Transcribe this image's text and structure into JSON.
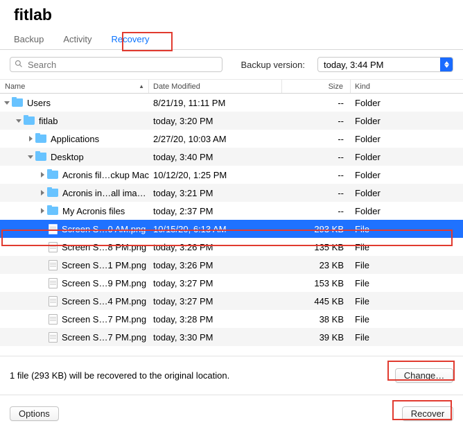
{
  "header": {
    "title": "fitlab"
  },
  "tabs": [
    {
      "label": "Backup",
      "active": false
    },
    {
      "label": "Activity",
      "active": false
    },
    {
      "label": "Recovery",
      "active": true
    }
  ],
  "search": {
    "placeholder": "Search"
  },
  "backup_version": {
    "label": "Backup version:",
    "value": "today, 3:44 PM"
  },
  "columns": [
    "Name",
    "Date Modified",
    "Size",
    "Kind"
  ],
  "rows": [
    {
      "depth": 0,
      "hasChildren": true,
      "open": true,
      "icon": "folder",
      "name": "Users",
      "date": "8/21/19, 11:11 PM",
      "size": "--",
      "kind": "Folder",
      "selected": false
    },
    {
      "depth": 1,
      "hasChildren": true,
      "open": true,
      "icon": "folder",
      "name": "fitlab",
      "date": "today, 3:20 PM",
      "size": "--",
      "kind": "Folder",
      "selected": false
    },
    {
      "depth": 2,
      "hasChildren": true,
      "open": false,
      "icon": "folder",
      "name": "Applications",
      "date": "2/27/20, 10:03 AM",
      "size": "--",
      "kind": "Folder",
      "selected": false
    },
    {
      "depth": 2,
      "hasChildren": true,
      "open": true,
      "icon": "folder",
      "name": "Desktop",
      "date": "today, 3:40 PM",
      "size": "--",
      "kind": "Folder",
      "selected": false
    },
    {
      "depth": 3,
      "hasChildren": true,
      "open": false,
      "icon": "folder",
      "name": "Acronis fil…ckup Mac",
      "date": "10/12/20, 1:25 PM",
      "size": "--",
      "kind": "Folder",
      "selected": false
    },
    {
      "depth": 3,
      "hasChildren": true,
      "open": false,
      "icon": "folder",
      "name": "Acronis in…all images",
      "date": "today, 3:21 PM",
      "size": "--",
      "kind": "Folder",
      "selected": false
    },
    {
      "depth": 3,
      "hasChildren": true,
      "open": false,
      "icon": "folder",
      "name": "My Acronis files",
      "date": "today, 2:37 PM",
      "size": "--",
      "kind": "Folder",
      "selected": false
    },
    {
      "depth": 3,
      "hasChildren": false,
      "open": false,
      "icon": "file",
      "name": "Screen S…0 AM.png",
      "date": "10/15/20, 6:13 AM",
      "size": "293 KB",
      "kind": "File",
      "selected": true
    },
    {
      "depth": 3,
      "hasChildren": false,
      "open": false,
      "icon": "file",
      "name": "Screen S…8 PM.png",
      "date": "today, 3:26 PM",
      "size": "135 KB",
      "kind": "File",
      "selected": false
    },
    {
      "depth": 3,
      "hasChildren": false,
      "open": false,
      "icon": "file",
      "name": "Screen S…1 PM.png",
      "date": "today, 3:26 PM",
      "size": "23 KB",
      "kind": "File",
      "selected": false
    },
    {
      "depth": 3,
      "hasChildren": false,
      "open": false,
      "icon": "file",
      "name": "Screen S…9 PM.png",
      "date": "today, 3:27 PM",
      "size": "153 KB",
      "kind": "File",
      "selected": false
    },
    {
      "depth": 3,
      "hasChildren": false,
      "open": false,
      "icon": "file",
      "name": "Screen S…4 PM.png",
      "date": "today, 3:27 PM",
      "size": "445 KB",
      "kind": "File",
      "selected": false
    },
    {
      "depth": 3,
      "hasChildren": false,
      "open": false,
      "icon": "file",
      "name": "Screen S…7 PM.png",
      "date": "today, 3:28 PM",
      "size": "38 KB",
      "kind": "File",
      "selected": false
    },
    {
      "depth": 3,
      "hasChildren": false,
      "open": false,
      "icon": "file",
      "name": "Screen S…7 PM.png",
      "date": "today, 3:30 PM",
      "size": "39 KB",
      "kind": "File",
      "selected": false
    }
  ],
  "footer": {
    "status": "1 file (293 KB) will be recovered to the original location.",
    "change_label": "Change…",
    "options_label": "Options",
    "recover_label": "Recover"
  }
}
